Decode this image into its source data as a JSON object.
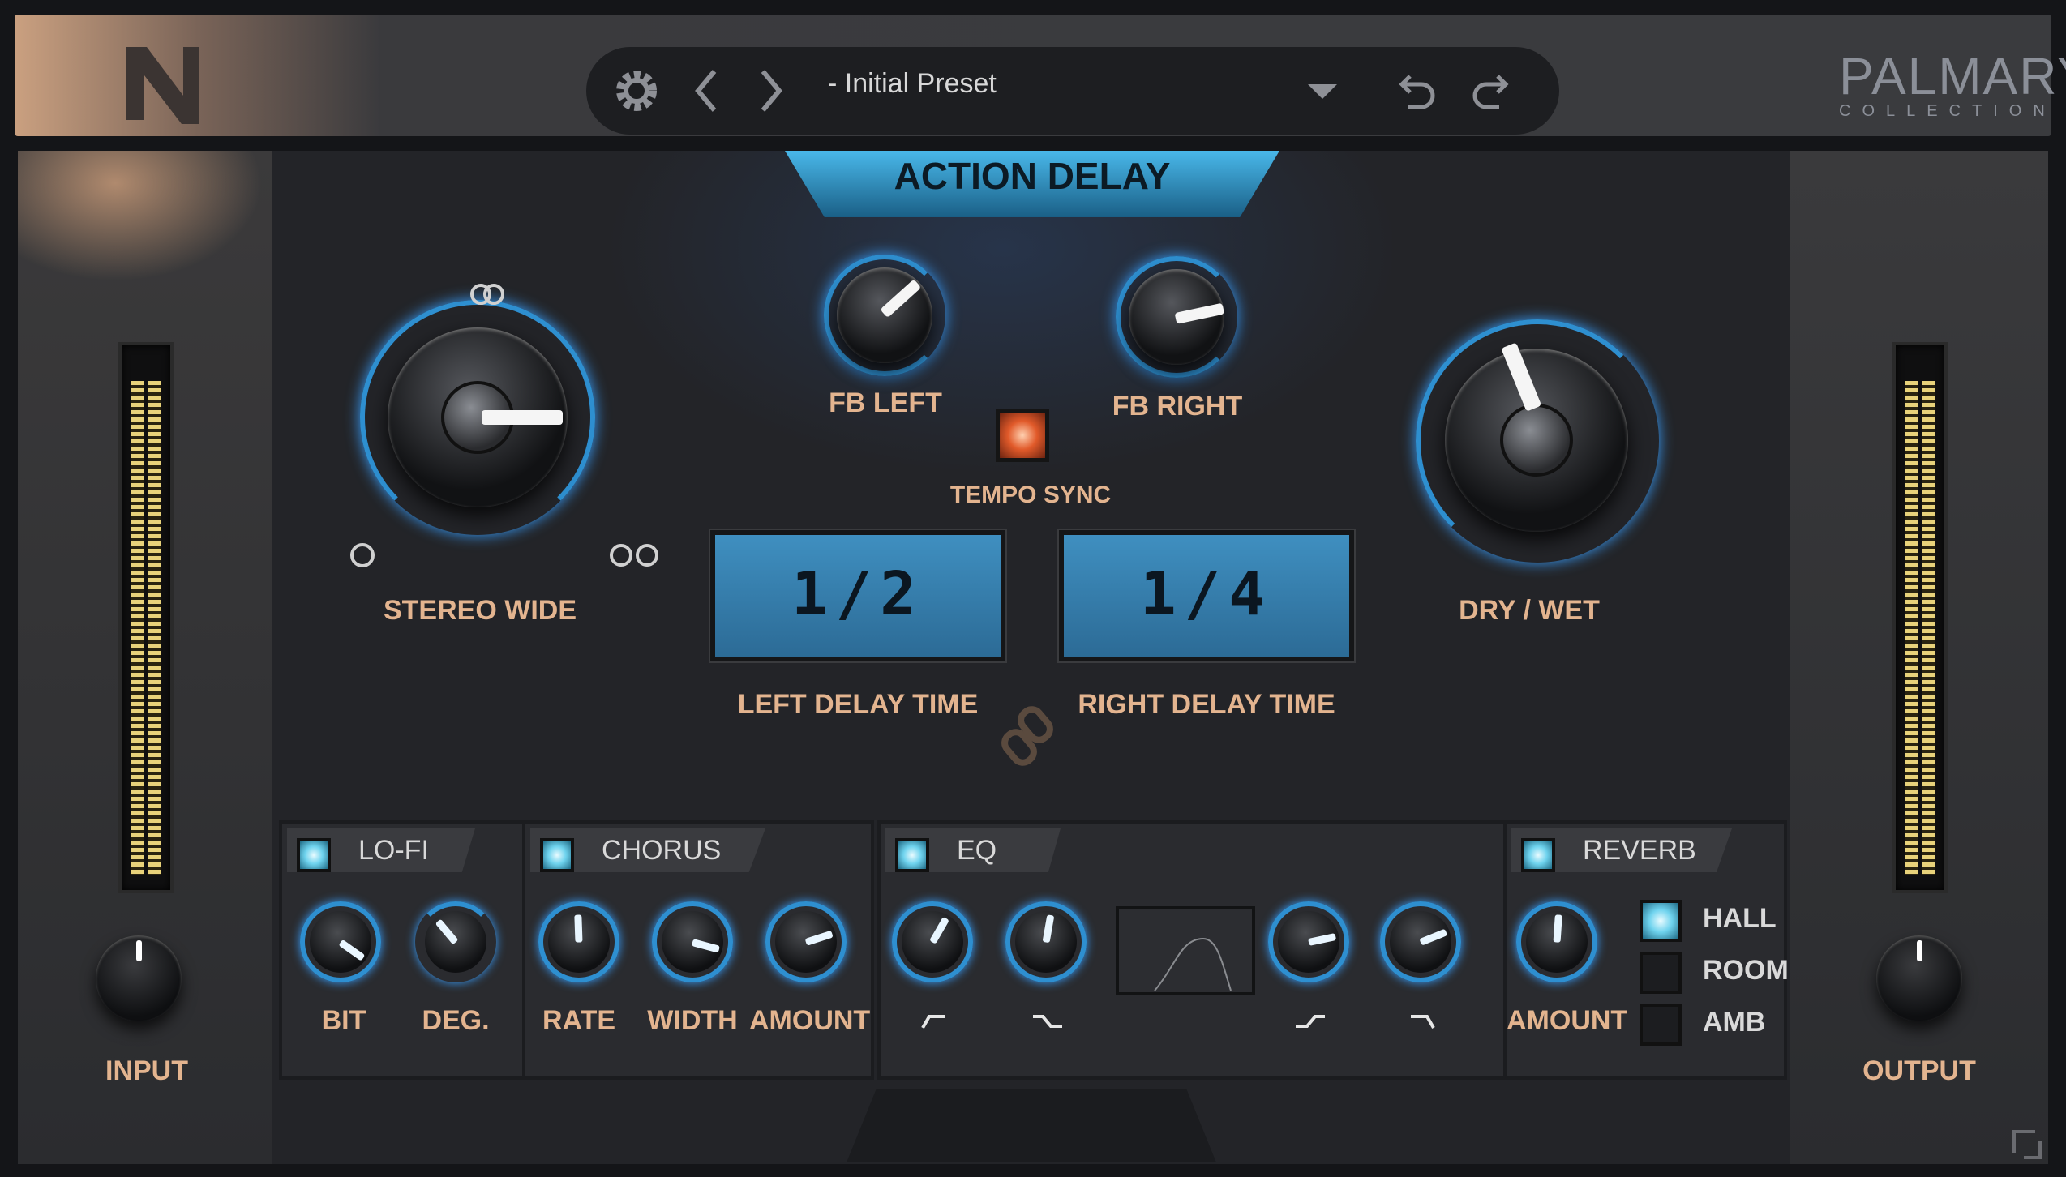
{
  "header": {
    "logo": "N",
    "preset_name": "- Initial Preset",
    "brand_title": "PALMARY",
    "brand_subtitle": "COLLECTION",
    "icons": [
      "gear-icon",
      "chevron-left-icon",
      "chevron-right-icon",
      "dropdown-arrow-icon",
      "undo-icon",
      "redo-icon"
    ]
  },
  "main": {
    "title": "ACTION DELAY",
    "stereo_wide_label": "STEREO WIDE",
    "fb_left_label": "FB LEFT",
    "fb_right_label": "FB RIGHT",
    "tempo_sync_label": "TEMPO SYNC",
    "dry_wet_label": "DRY / WET",
    "left_delay": {
      "value": "1/2",
      "label": "LEFT DELAY TIME"
    },
    "right_delay": {
      "value": "1/4",
      "label": "RIGHT DELAY TIME"
    }
  },
  "sides": {
    "input_label": "INPUT",
    "output_label": "OUTPUT"
  },
  "fx": {
    "lofi": {
      "name": "LO-FI",
      "knobs": [
        "BIT",
        "DEG."
      ]
    },
    "chorus": {
      "name": "CHORUS",
      "knobs": [
        "RATE",
        "WIDTH",
        "AMOUNT"
      ]
    },
    "eq": {
      "name": "EQ"
    },
    "reverb": {
      "name": "REVERB",
      "amount_label": "AMOUNT",
      "options": [
        "HALL",
        "ROOM",
        "AMB"
      ],
      "selected": "HALL"
    }
  },
  "colors": {
    "accent": "#2e8fd0",
    "label": "#e3b48f",
    "lcd": "#3f8fc0"
  }
}
